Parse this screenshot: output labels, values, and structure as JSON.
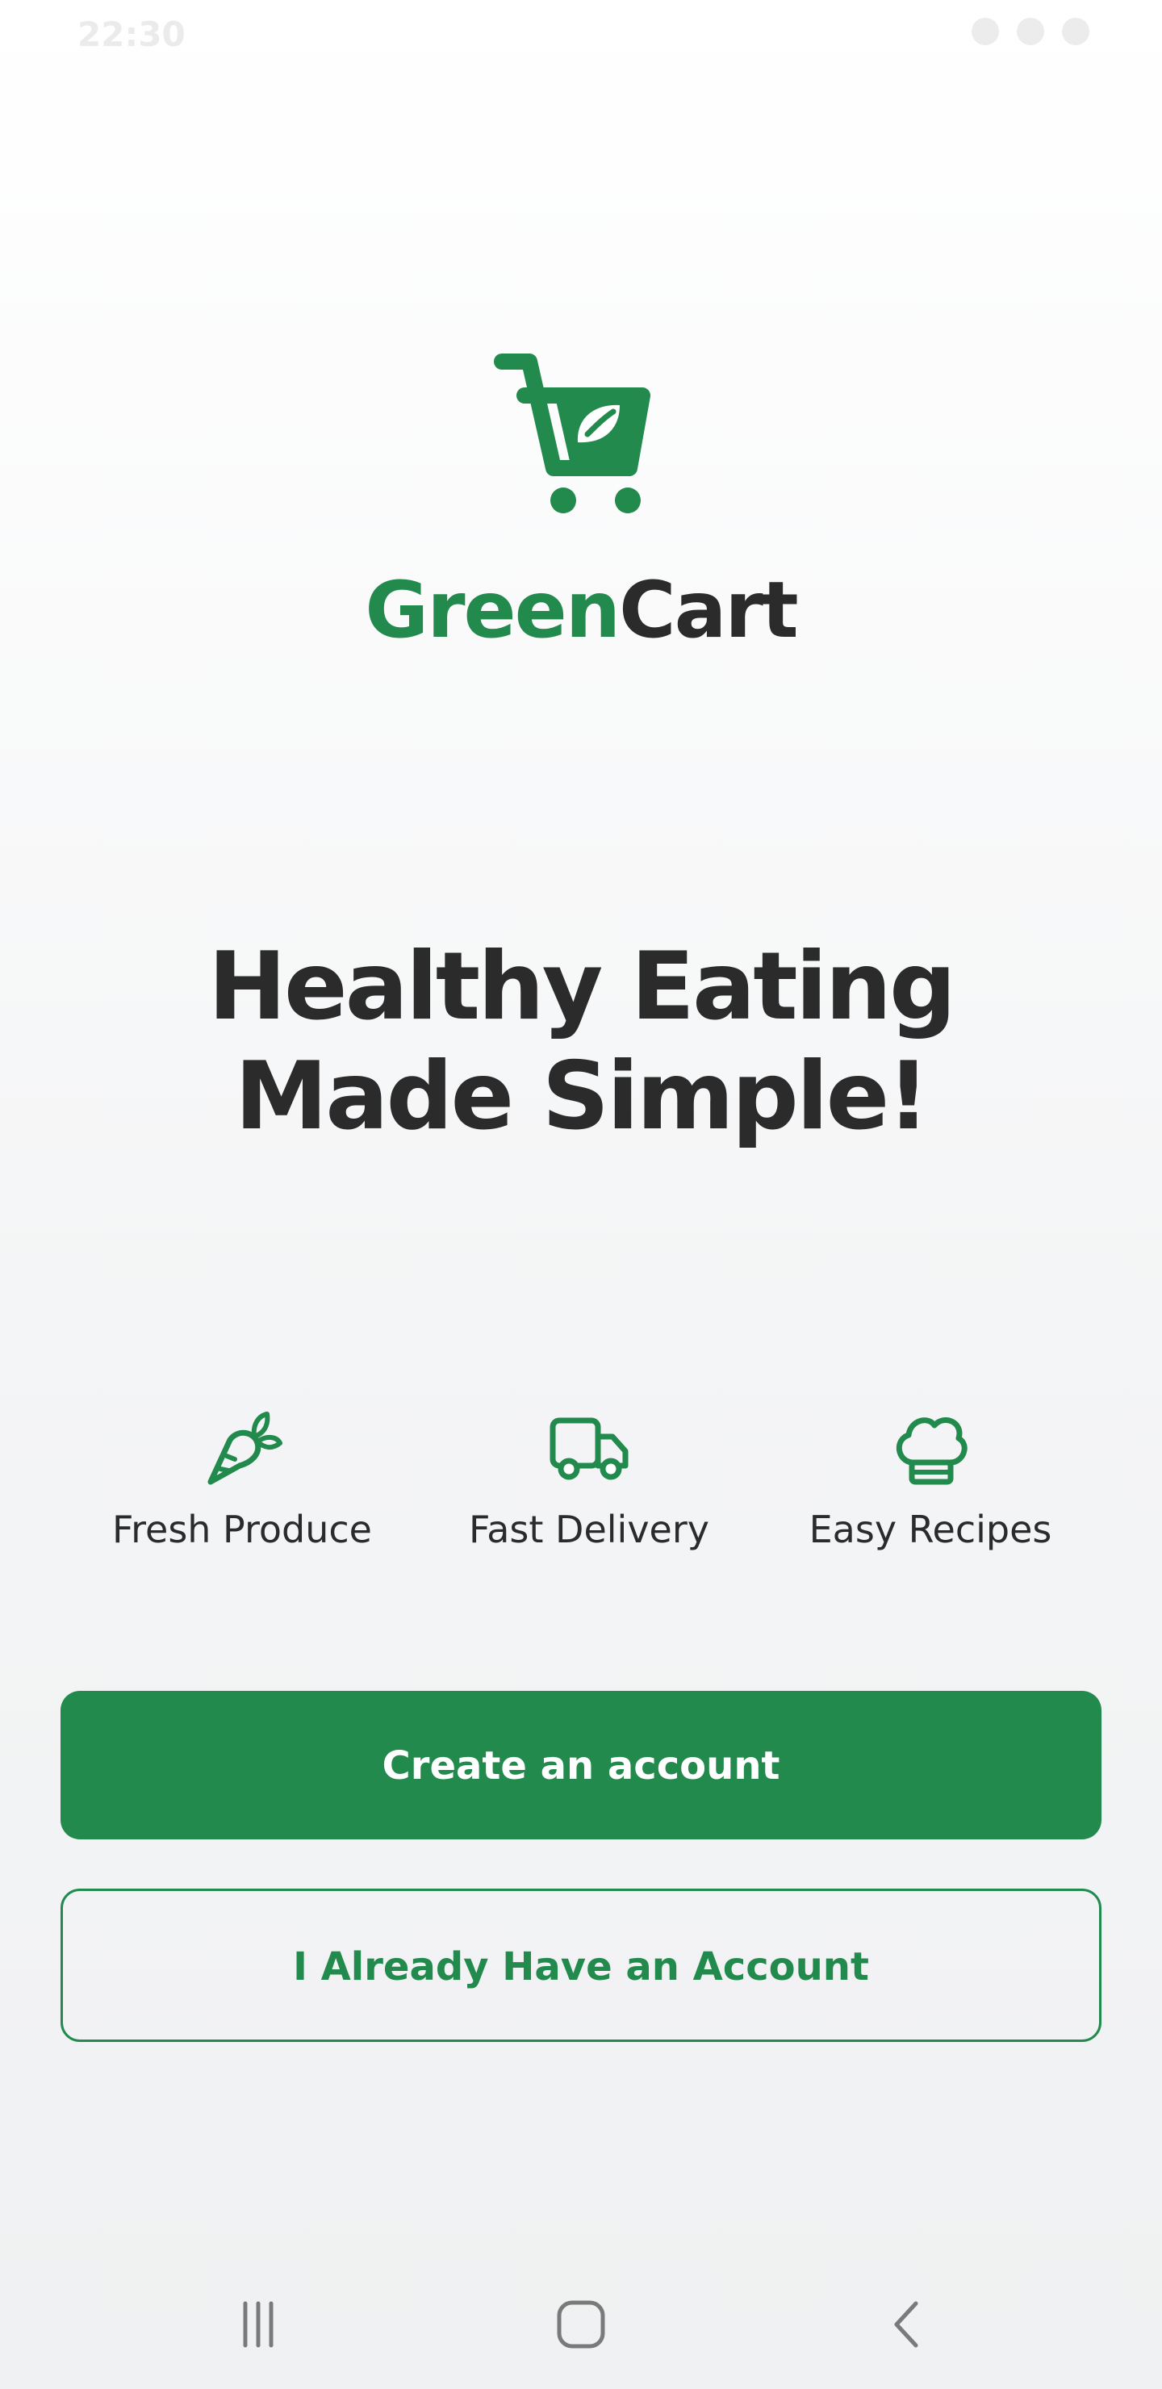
{
  "status_bar": {
    "time": "22:30"
  },
  "brand": {
    "part1": "Green",
    "part2": "Cart",
    "accent_color": "#218a4c",
    "dark_color": "#2b2b2b",
    "logo_icon": "shopping-cart-icon"
  },
  "headline": {
    "line1": "Healthy Eating",
    "line2": "Made Simple!"
  },
  "features": [
    {
      "label": "Fresh Produce",
      "icon": "carrot-icon"
    },
    {
      "label": "Fast Delivery",
      "icon": "truck-icon"
    },
    {
      "label": "Easy Recipes",
      "icon": "chef-hat-icon"
    }
  ],
  "buttons": {
    "create_account": "Create an account",
    "have_account": "I Already Have an Account"
  },
  "nav": {
    "recents_icon": "recents-icon",
    "home_icon": "home-icon",
    "back_icon": "back-icon"
  }
}
